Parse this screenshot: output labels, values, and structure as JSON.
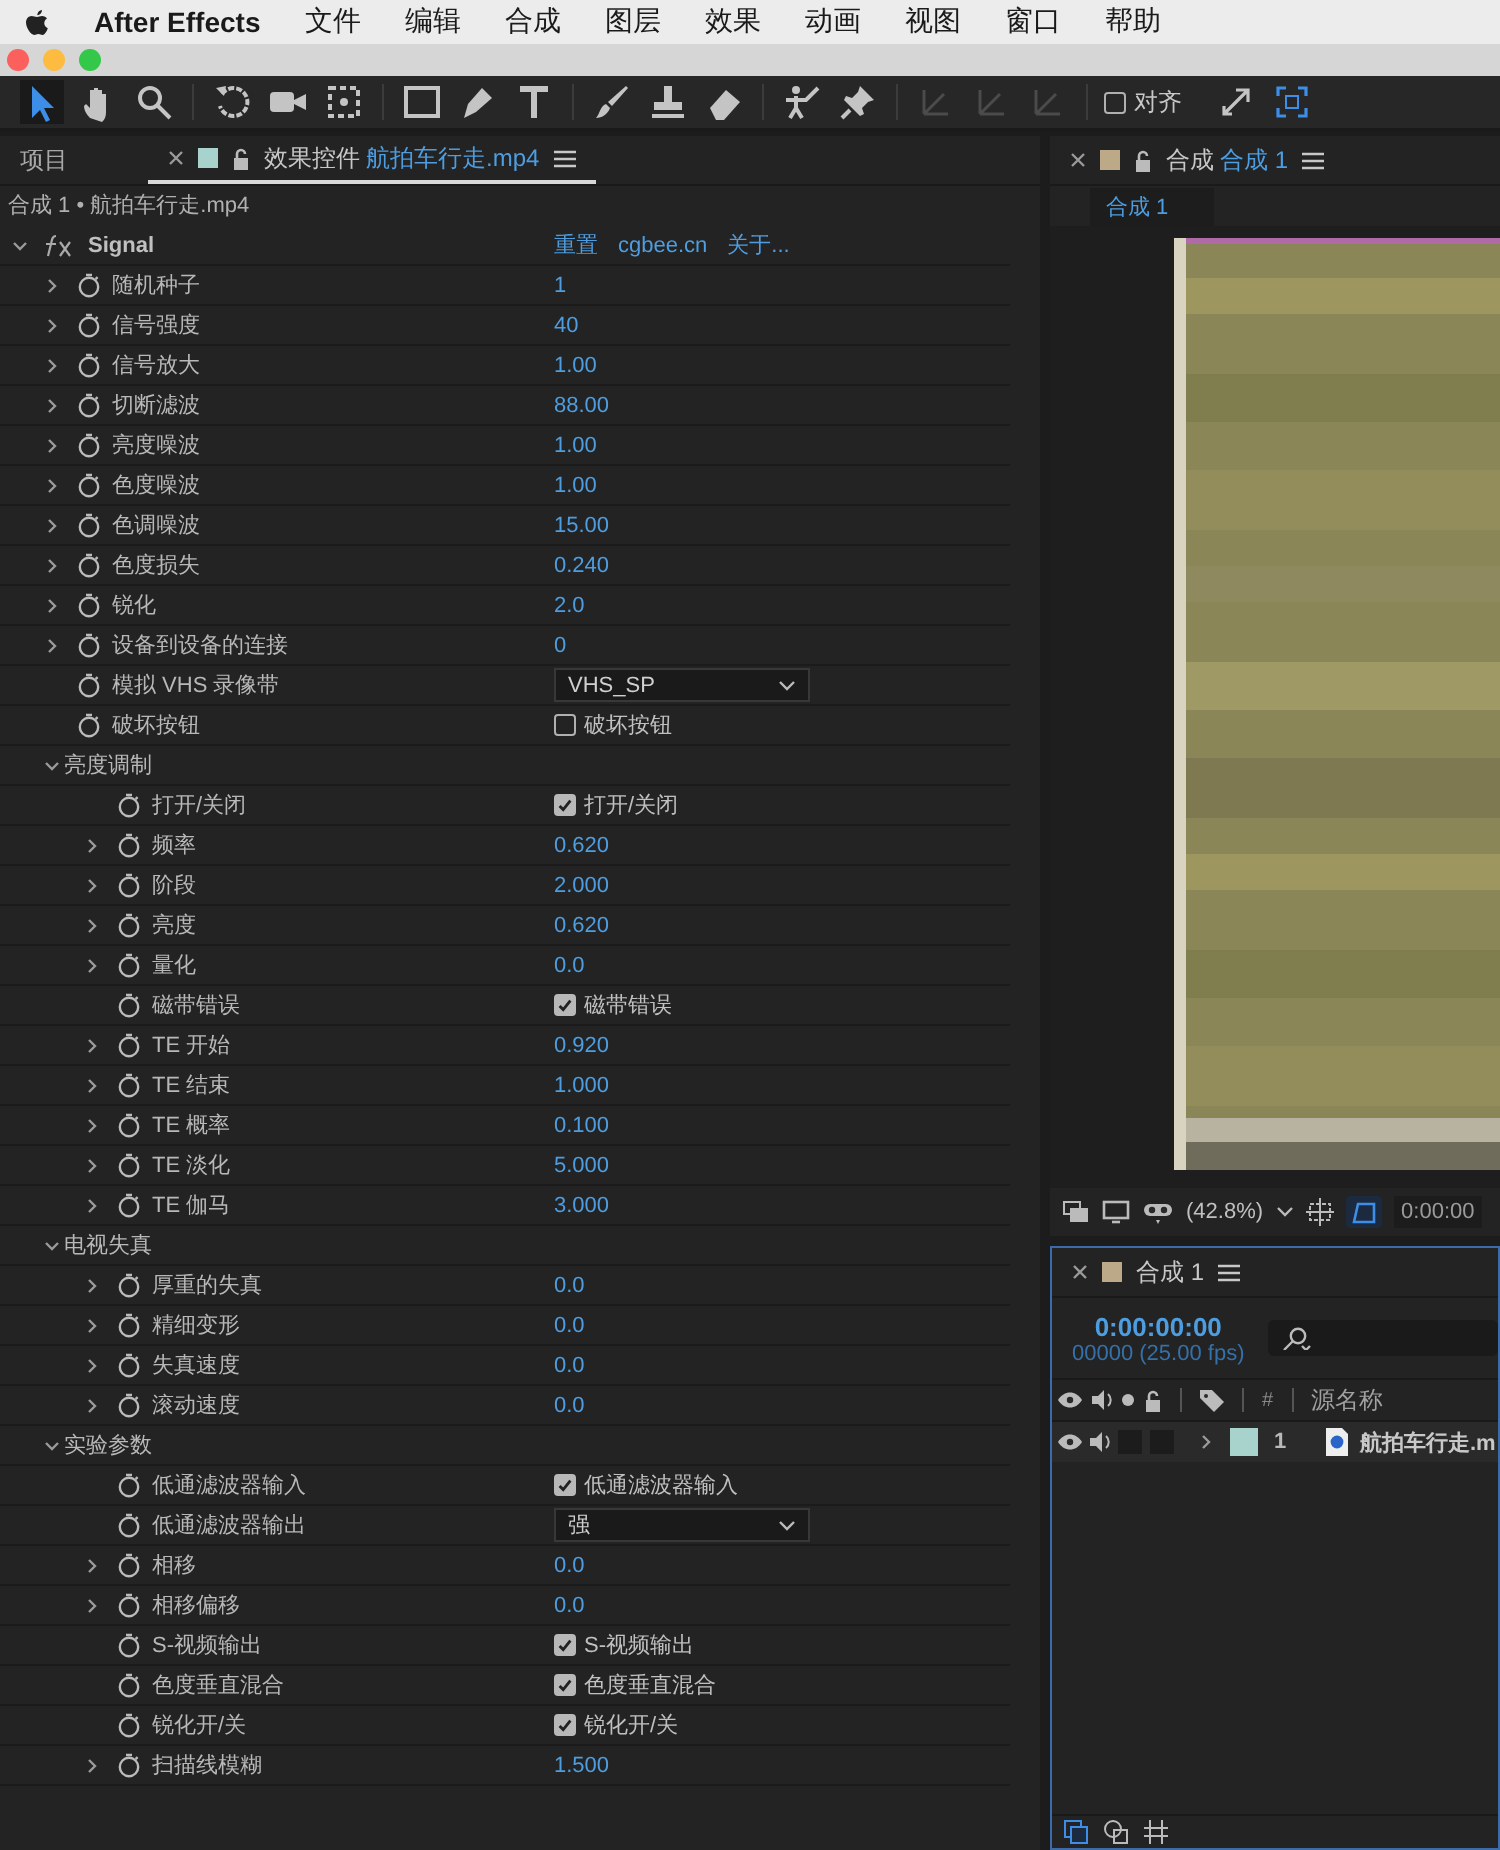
{
  "menu_bar": {
    "app": "After Effects",
    "items": [
      "文件",
      "编辑",
      "合成",
      "图层",
      "效果",
      "动画",
      "视图",
      "窗口",
      "帮助"
    ]
  },
  "toolbar": {
    "tools": [
      {
        "kind": "selection",
        "selected": true,
        "disabled": false
      },
      {
        "kind": "hand",
        "selected": false,
        "disabled": false
      },
      {
        "kind": "zoom",
        "selected": false,
        "disabled": false
      },
      {
        "kind": "rotate",
        "selected": false,
        "disabled": false
      },
      {
        "kind": "camera",
        "selected": false,
        "disabled": false
      },
      {
        "kind": "pan",
        "selected": false,
        "disabled": false
      },
      {
        "kind": "rectangle",
        "selected": false,
        "disabled": false
      },
      {
        "kind": "pen",
        "selected": false,
        "disabled": false
      },
      {
        "kind": "text",
        "selected": false,
        "disabled": false
      },
      {
        "kind": "brush",
        "selected": false,
        "disabled": false
      },
      {
        "kind": "stamp",
        "selected": false,
        "disabled": false
      },
      {
        "kind": "eraser",
        "selected": false,
        "disabled": false
      },
      {
        "kind": "puppet",
        "selected": false,
        "disabled": false
      },
      {
        "kind": "pin",
        "selected": false,
        "disabled": false
      },
      {
        "kind": "axis",
        "selected": false,
        "disabled": true
      },
      {
        "kind": "axis",
        "selected": false,
        "disabled": true
      },
      {
        "kind": "axis",
        "selected": false,
        "disabled": true
      }
    ],
    "snap": {
      "label": "对齐",
      "checked": false
    }
  },
  "effect_controls": {
    "tabs": [
      {
        "label": "项目",
        "selected": false
      },
      {
        "label": "效果控件",
        "file": "航拍车行走.mp4",
        "color": "#a8d3cc",
        "selected": true
      }
    ],
    "breadcrumb": "合成 1 • 航拍车行走.mp4",
    "effect": {
      "name": "Signal",
      "expanded": true,
      "links": [
        "重置",
        "cgbee.cn",
        "关于..."
      ],
      "children": [
        {
          "kind": "value",
          "label": "随机种子",
          "value": "1",
          "expandable": true
        },
        {
          "kind": "value",
          "label": "信号强度",
          "value": "40",
          "expandable": true
        },
        {
          "kind": "value",
          "label": "信号放大",
          "value": "1.00",
          "expandable": true
        },
        {
          "kind": "value",
          "label": "切断滤波",
          "value": "88.00",
          "expandable": true
        },
        {
          "kind": "value",
          "label": "亮度噪波",
          "value": "1.00",
          "expandable": true
        },
        {
          "kind": "value",
          "label": "色度噪波",
          "value": "1.00",
          "expandable": true
        },
        {
          "kind": "value",
          "label": "色调噪波",
          "value": "15.00",
          "expandable": true
        },
        {
          "kind": "value",
          "label": "色度损失",
          "value": "0.240",
          "expandable": true
        },
        {
          "kind": "value",
          "label": "锐化",
          "value": "2.0",
          "expandable": true
        },
        {
          "kind": "value",
          "label": "设备到设备的连接",
          "value": "0",
          "expandable": true
        },
        {
          "kind": "dropdown",
          "label": "模拟 VHS 录像带",
          "value": "VHS_SP",
          "expandable": false
        },
        {
          "kind": "checkbox",
          "label": "破坏按钮",
          "value": "破坏按钮",
          "checked": false,
          "expandable": false
        },
        {
          "kind": "group",
          "label": "亮度调制",
          "expanded": true,
          "children": [
            {
              "kind": "checkbox",
              "label": "打开/关闭",
              "value": "打开/关闭",
              "checked": true,
              "expandable": false
            },
            {
              "kind": "value",
              "label": "频率",
              "value": "0.620",
              "expandable": true
            },
            {
              "kind": "value",
              "label": "阶段",
              "value": "2.000",
              "expandable": true
            },
            {
              "kind": "value",
              "label": "亮度",
              "value": "0.620",
              "expandable": true
            },
            {
              "kind": "value",
              "label": "量化",
              "value": "0.0",
              "expandable": true
            },
            {
              "kind": "checkbox",
              "label": "磁带错误",
              "value": "磁带错误",
              "checked": true,
              "expandable": false
            },
            {
              "kind": "value",
              "label": "TE 开始",
              "value": "0.920",
              "expandable": true
            },
            {
              "kind": "value",
              "label": "TE 结束",
              "value": "1.000",
              "expandable": true
            },
            {
              "kind": "value",
              "label": "TE 概率",
              "value": "0.100",
              "expandable": true
            },
            {
              "kind": "value",
              "label": "TE 淡化",
              "value": "5.000",
              "expandable": true
            },
            {
              "kind": "value",
              "label": "TE 伽马",
              "value": "3.000",
              "expandable": true
            }
          ]
        },
        {
          "kind": "group",
          "label": "电视失真",
          "expanded": true,
          "children": [
            {
              "kind": "value",
              "label": "厚重的失真",
              "value": "0.0",
              "expandable": true
            },
            {
              "kind": "value",
              "label": "精细变形",
              "value": "0.0",
              "expandable": true
            },
            {
              "kind": "value",
              "label": "失真速度",
              "value": "0.0",
              "expandable": true
            },
            {
              "kind": "value",
              "label": "滚动速度",
              "value": "0.0",
              "expandable": true
            }
          ]
        },
        {
          "kind": "group",
          "label": "实验参数",
          "expanded": true,
          "children": [
            {
              "kind": "checkbox",
              "label": "低通滤波器输入",
              "value": "低通滤波器输入",
              "checked": true,
              "expandable": false
            },
            {
              "kind": "dropdown",
              "label": "低通滤波器输出",
              "value": "强",
              "expandable": false
            },
            {
              "kind": "value",
              "label": "相移",
              "value": "0.0",
              "expandable": true
            },
            {
              "kind": "value",
              "label": "相移偏移",
              "value": "0.0",
              "expandable": true
            },
            {
              "kind": "checkbox",
              "label": "S-视频输出",
              "value": "S-视频输出",
              "checked": true,
              "expandable": false
            },
            {
              "kind": "checkbox",
              "label": "色度垂直混合",
              "value": "色度垂直混合",
              "checked": true,
              "expandable": false
            },
            {
              "kind": "checkbox",
              "label": "锐化开/关",
              "value": "锐化开/关",
              "checked": true,
              "expandable": false
            },
            {
              "kind": "value",
              "label": "扫描线模糊",
              "value": "1.500",
              "expandable": true
            }
          ]
        }
      ]
    }
  },
  "composition": {
    "tab": {
      "prefix": "合成",
      "name": "合成 1",
      "color": "#bba987"
    },
    "view_tab": "合成 1",
    "zoom": "(42.8%)",
    "timecode": "0:00:00"
  },
  "timeline": {
    "title": "合成 1",
    "color": "#bba987",
    "time": "0:00:00:00",
    "frames": "00000 (25.00 fps)",
    "columns": [
      "#",
      "源名称"
    ],
    "layers": [
      {
        "number": "1",
        "name": "航拍车行走.m",
        "color": "#a8d3cc",
        "visible": true,
        "audio": true
      }
    ]
  }
}
